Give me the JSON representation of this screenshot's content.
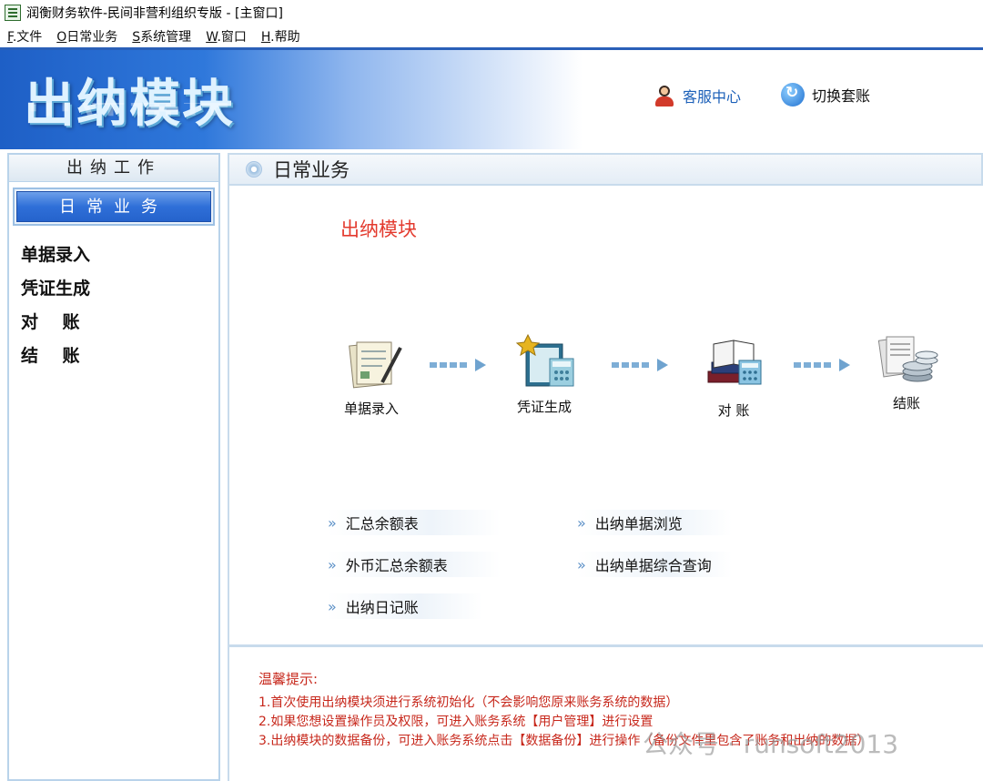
{
  "window": {
    "title": "润衡财务软件-民间非营利组织专版 - [主窗口]"
  },
  "menu": [
    {
      "key": "F",
      "label": ".文件"
    },
    {
      "key": "O",
      "label": "日常业务"
    },
    {
      "key": "S",
      "label": "系统管理"
    },
    {
      "key": "W",
      "label": ".窗口"
    },
    {
      "key": "H",
      "label": ".帮助"
    }
  ],
  "banner": {
    "title": "出纳模块",
    "service_center": "客服中心",
    "switch_account": "切换套账"
  },
  "sidebar": {
    "header": "出纳工作",
    "active_tab": "日常业务",
    "items": [
      {
        "label": "单据录入"
      },
      {
        "label": "凭证生成"
      },
      {
        "label": "对    账"
      },
      {
        "label": "结    账"
      }
    ]
  },
  "main": {
    "header": "日常业务",
    "module_title": "出纳模块",
    "flow": [
      {
        "label": "单据录入",
        "icon": "document-icon"
      },
      {
        "label": "凭证生成",
        "icon": "voucher-icon"
      },
      {
        "label": "对 账",
        "icon": "reconcile-icon"
      },
      {
        "label": "结账",
        "icon": "close-books-icon"
      }
    ],
    "links": [
      {
        "label": "汇总余额表"
      },
      {
        "label": "出纳单据浏览"
      },
      {
        "label": "外币汇总余额表"
      },
      {
        "label": "出纳单据综合查询"
      },
      {
        "label": "出纳日记账"
      }
    ]
  },
  "tips": {
    "title": "温馨提示:",
    "lines": [
      "1.首次使用出纳模块须进行系统初始化（不会影响您原来账务系统的数据）",
      "2.如果您想设置操作员及权限，可进入账务系统【用户管理】进行设置",
      "3.出纳模块的数据备份，可进入账务系统点击【数据备份】进行操作（备份文件里包含了账务和出纳的数据）"
    ]
  },
  "watermark": "公众号 · runsoft2013",
  "colors": {
    "accent_blue": "#2f6fd8",
    "tip_red": "#c7281c",
    "title_red": "#e33a2e"
  }
}
